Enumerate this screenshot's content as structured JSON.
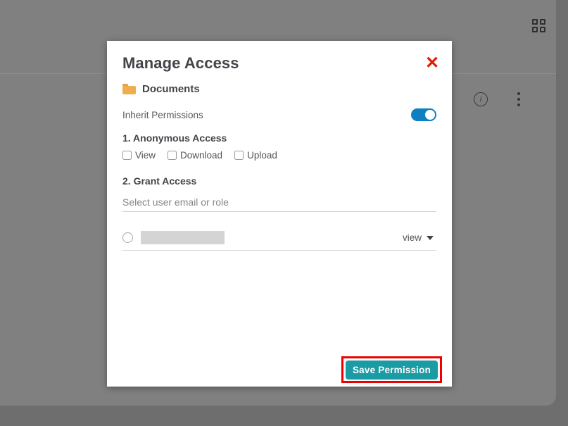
{
  "background": {
    "apps_icon": "grid-apps-icon",
    "info_icon": "info-icon",
    "info_glyph": "i",
    "more_icon": "more-vertical-icon",
    "overlay_color": "#808080"
  },
  "dialog": {
    "title": "Manage Access",
    "close_icon": "close-icon",
    "close_glyph": "✕",
    "close_color": "#e11b00",
    "folder": {
      "icon": "folder-icon",
      "icon_color": "#eeae4e",
      "name": "Documents"
    },
    "inherit": {
      "label": "Inherit Permissions",
      "toggle_state": "on",
      "toggle_color": "#0e80c2"
    },
    "anonymous_access": {
      "title": "1. Anonymous Access",
      "options": [
        {
          "label": "View",
          "checked": false
        },
        {
          "label": "Download",
          "checked": false
        },
        {
          "label": "Upload",
          "checked": false
        }
      ]
    },
    "grant_access": {
      "title": "2. Grant Access",
      "input_placeholder": "Select user email or role",
      "input_value": "",
      "entries": [
        {
          "name": "",
          "name_redacted": true,
          "permission": "view",
          "selected": false
        }
      ]
    },
    "save": {
      "label": "Save Permission",
      "button_color": "#1b9ba3",
      "highlight_color": "#ee0000"
    }
  }
}
